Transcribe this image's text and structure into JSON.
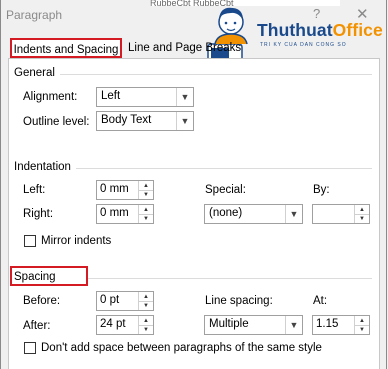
{
  "window": {
    "title": "Paragraph",
    "doc_snippet": "RubbeCbt RubbeCbt",
    "help_glyph": "?",
    "close_glyph": "✕"
  },
  "tabs": [
    {
      "label": "Indents and Spacing"
    },
    {
      "label": "Line and Page Breaks"
    }
  ],
  "watermark": {
    "brand_part1": "Thuthuat",
    "brand_part2": "Office",
    "tagline": "TRI KY CUA DAN CONG SO",
    "brand_colors": {
      "navy": "#1a4a8c",
      "orange": "#f39200"
    }
  },
  "general": {
    "label": "General",
    "alignment": {
      "label": "Alignment:",
      "value": "Left"
    },
    "outline": {
      "label": "Outline level:",
      "value": "Body Text"
    }
  },
  "indentation": {
    "label": "Indentation",
    "left": {
      "label": "Left:",
      "value": "0 mm"
    },
    "right": {
      "label": "Right:",
      "value": "0 mm"
    },
    "special": {
      "label": "Special:",
      "value": "(none)"
    },
    "by": {
      "label": "By:",
      "value": ""
    },
    "mirror": {
      "label": "Mirror indents"
    }
  },
  "spacing": {
    "label": "Spacing",
    "before": {
      "label": "Before:",
      "value": "0 pt"
    },
    "after": {
      "label": "After:",
      "value": "24 pt"
    },
    "line_spacing": {
      "label": "Line spacing:",
      "value": "Multiple"
    },
    "at": {
      "label": "At:",
      "value": "1.15"
    },
    "dont_add": {
      "label": "Don't add space between paragraphs of the same style"
    }
  },
  "highlight_color": "#d41b24"
}
